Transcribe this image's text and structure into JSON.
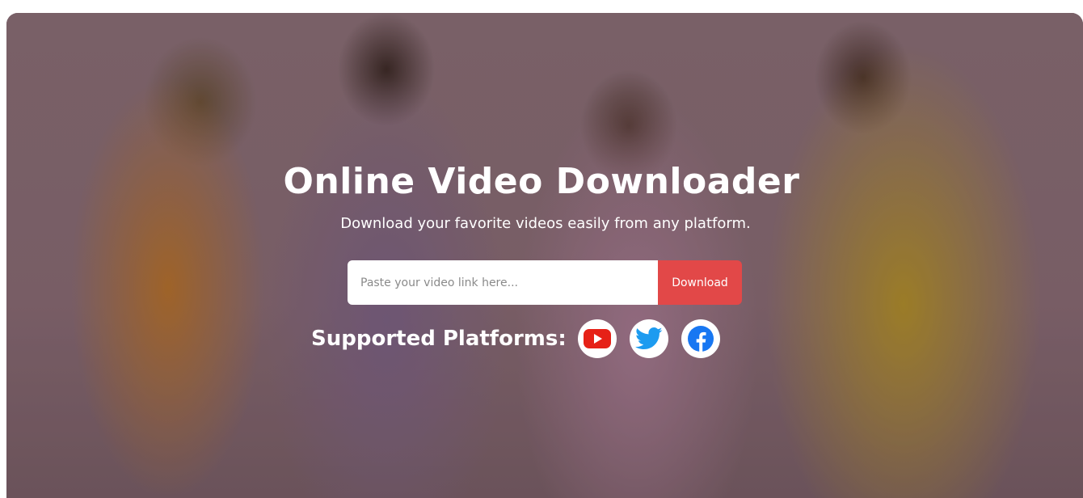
{
  "hero": {
    "title": "Online Video Downloader",
    "subtitle": "Download your favorite videos easily from any platform."
  },
  "search": {
    "placeholder": "Paste your video link here...",
    "value": "",
    "button_label": "Download"
  },
  "platforms": {
    "label": "Supported Platforms:",
    "items": [
      {
        "name": "YouTube",
        "icon": "youtube-icon",
        "color": "#e62117"
      },
      {
        "name": "Twitter",
        "icon": "twitter-icon",
        "color": "#1d9bf0"
      },
      {
        "name": "Facebook",
        "icon": "facebook-icon",
        "color": "#1877f2"
      }
    ]
  },
  "colors": {
    "accent": "#e24848",
    "overlay": "#8a6f77",
    "text": "#ffffff"
  }
}
